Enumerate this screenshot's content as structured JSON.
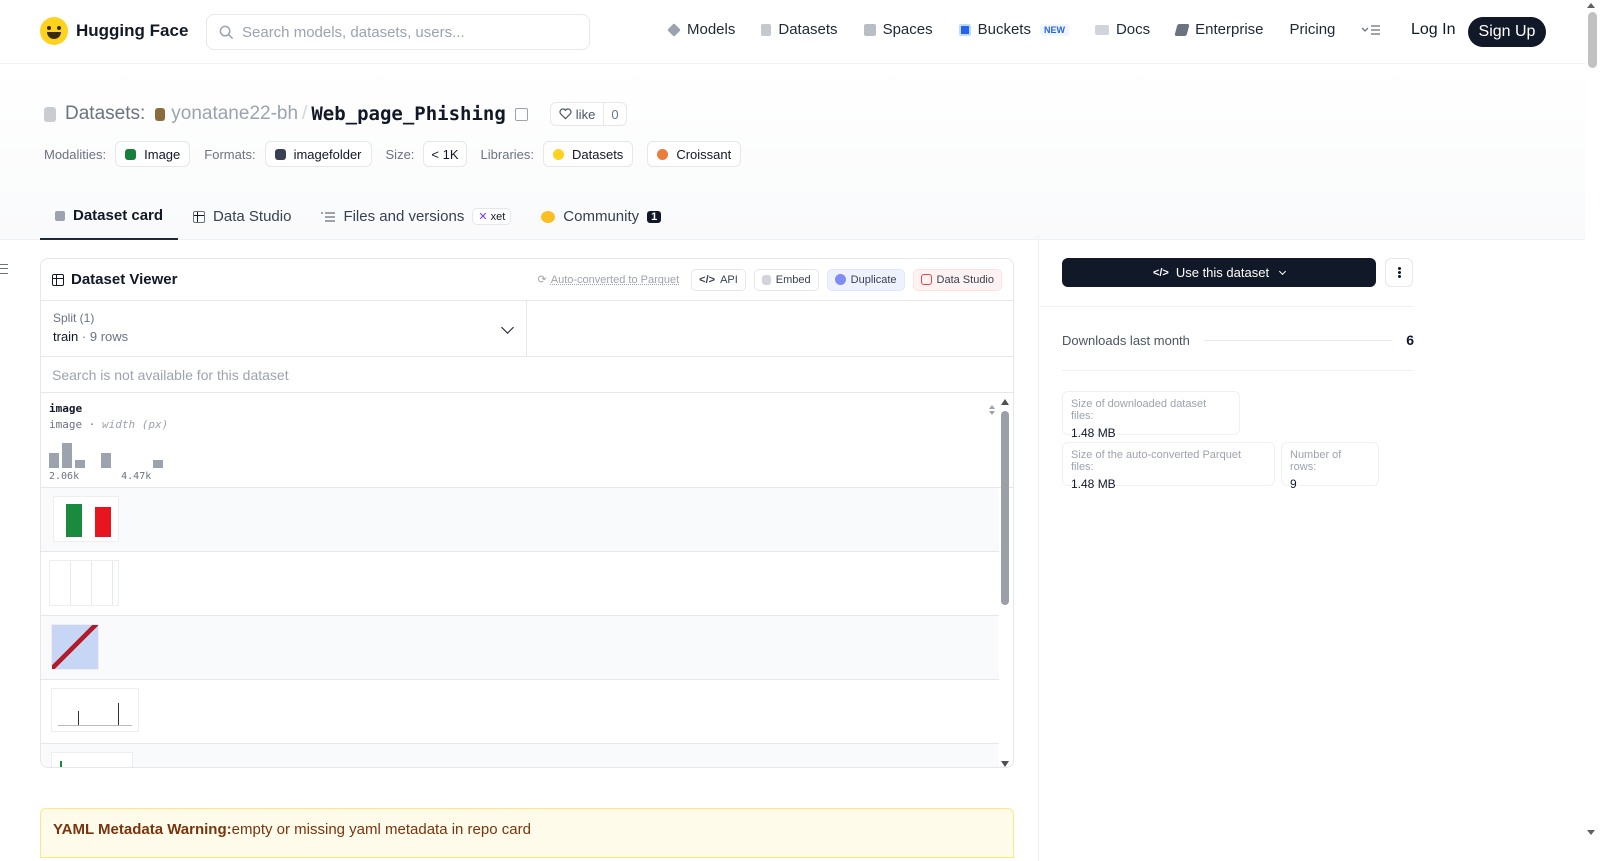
{
  "nav": {
    "logo_text": "Hugging Face",
    "search_placeholder": "Search models, datasets, users...",
    "links": [
      {
        "label": "Models",
        "icon": "cube-icon"
      },
      {
        "label": "Datasets",
        "icon": "database-icon"
      },
      {
        "label": "Spaces",
        "icon": "grid-icon"
      },
      {
        "label": "Buckets",
        "icon": "bucket-icon",
        "badge": "NEW"
      },
      {
        "label": "Docs",
        "icon": "book-icon"
      },
      {
        "label": "Enterprise",
        "icon": "enterprise-icon"
      },
      {
        "label": "Pricing"
      }
    ],
    "login": "Log In",
    "signup": "Sign Up"
  },
  "header": {
    "prefix": "Datasets:",
    "owner": "yonatane22-bh",
    "separator": "/",
    "repo": "Web_page_Phishing",
    "like_label": "like",
    "like_count": "0",
    "meta": {
      "modalities_label": "Modalities:",
      "modality": "Image",
      "formats_label": "Formats:",
      "format": "imagefolder",
      "size_label": "Size:",
      "size": "< 1K",
      "libraries_label": "Libraries:",
      "library_1": "Datasets",
      "library_2": "Croissant"
    }
  },
  "tabs": [
    {
      "label": "Dataset card",
      "active": true
    },
    {
      "label": "Data Studio"
    },
    {
      "label": "Files and versions",
      "badge": "xet"
    },
    {
      "label": "Community",
      "count": "1"
    }
  ],
  "viewer": {
    "title": "Dataset Viewer",
    "auto_converted": "Auto-converted to Parquet",
    "api": "API",
    "embed": "Embed",
    "duplicate": "Duplicate",
    "data_studio": "Data Studio",
    "split_label": "Split (1)",
    "split_name": "train",
    "split_rows": "9 rows",
    "search_na": "Search is not available for this dataset",
    "column": {
      "name": "image",
      "type": "image",
      "type_detail": "width (px)",
      "min": "2.06k",
      "max": "4.47k",
      "histogram": [
        0.6,
        1.0,
        0.3,
        0.0,
        0.6,
        0.0,
        0.0,
        0.0,
        0.3
      ]
    }
  },
  "warning": {
    "title": "YAML Metadata Warning:",
    "text": "empty or missing yaml metadata in repo card"
  },
  "sidebar": {
    "use_button": "Use this dataset",
    "downloads_label": "Downloads last month",
    "downloads_value": "6",
    "download_size_label": "Size of downloaded dataset files:",
    "download_size_value": "1.48 MB",
    "parquet_size_label": "Size of the auto-converted Parquet files:",
    "parquet_size_value": "1.48 MB",
    "num_rows_label": "Number of rows:",
    "num_rows_value": "9"
  },
  "colors": {
    "brand_yellow": "#ffd21e",
    "dark": "#111827",
    "warning_bg": "#fffbeb"
  }
}
